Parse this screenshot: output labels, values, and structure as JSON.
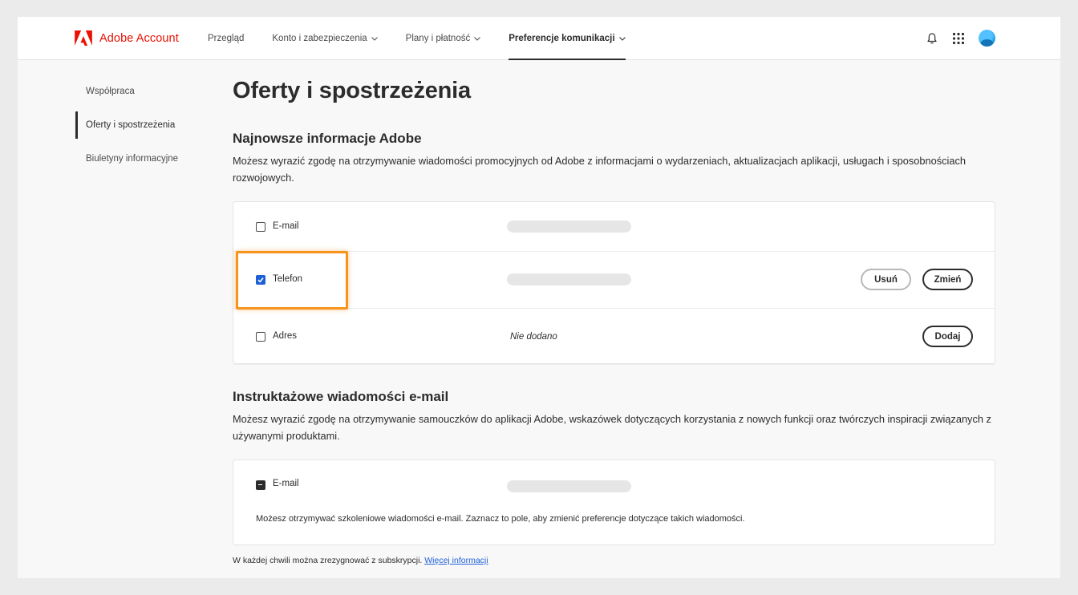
{
  "app": {
    "brand": "Adobe Account",
    "brand_color": "#eb1000"
  },
  "nav": {
    "items": [
      {
        "label": "Przegląd",
        "has_menu": false
      },
      {
        "label": "Konto i zabezpieczenia",
        "has_menu": true
      },
      {
        "label": "Plany i płatność",
        "has_menu": true
      },
      {
        "label": "Preferencje komunikacji",
        "has_menu": true,
        "active": true
      }
    ],
    "icons": [
      "bell-icon",
      "apps-grid-icon",
      "avatar"
    ]
  },
  "sidebar": {
    "items": [
      {
        "label": "Współpraca"
      },
      {
        "label": "Oferty i spostrzeżenia",
        "active": true
      },
      {
        "label": "Biuletyny informacyjne"
      }
    ]
  },
  "page": {
    "title": "Oferty i spostrzeżenia"
  },
  "adobe_updates": {
    "title": "Najnowsze informacje Adobe",
    "description": "Możesz wyrazić zgodę na otrzymywanie wiadomości promocyjnych od Adobe z informacjami o wydarzeniach, aktualizacjach aplikacji, usługach i sposobnościach rozwojowych.",
    "rows": {
      "email": {
        "label": "E-mail",
        "checked": false
      },
      "phone": {
        "label": "Telefon",
        "checked": true,
        "remove_label": "Usuń",
        "change_label": "Zmień"
      },
      "address": {
        "label": "Adres",
        "checked": false,
        "value": "Nie dodano",
        "add_label": "Dodaj"
      }
    }
  },
  "instructional": {
    "title": "Instruktażowe wiadomości e-mail",
    "description": "Możesz wyrazić zgodę na otrzymywanie samouczków do aplikacji Adobe, wskazówek dotyczących korzystania z nowych funkcji oraz twórczych inspiracji związanych z używanymi produktami.",
    "email": {
      "label": "E-mail",
      "state": "indeterminate"
    },
    "note": "Możesz otrzymywać szkoleniowe wiadomości e-mail. Zaznacz to pole, aby zmienić preferencje dotyczące takich wiadomości."
  },
  "footer": {
    "text": "W każdej chwili można zrezygnować z subskrypcji.",
    "link": "Więcej informacji"
  },
  "colors": {
    "highlight": "#f7941d",
    "checkbox_checked": "#1d5fd8",
    "link": "#1d5fd8"
  }
}
